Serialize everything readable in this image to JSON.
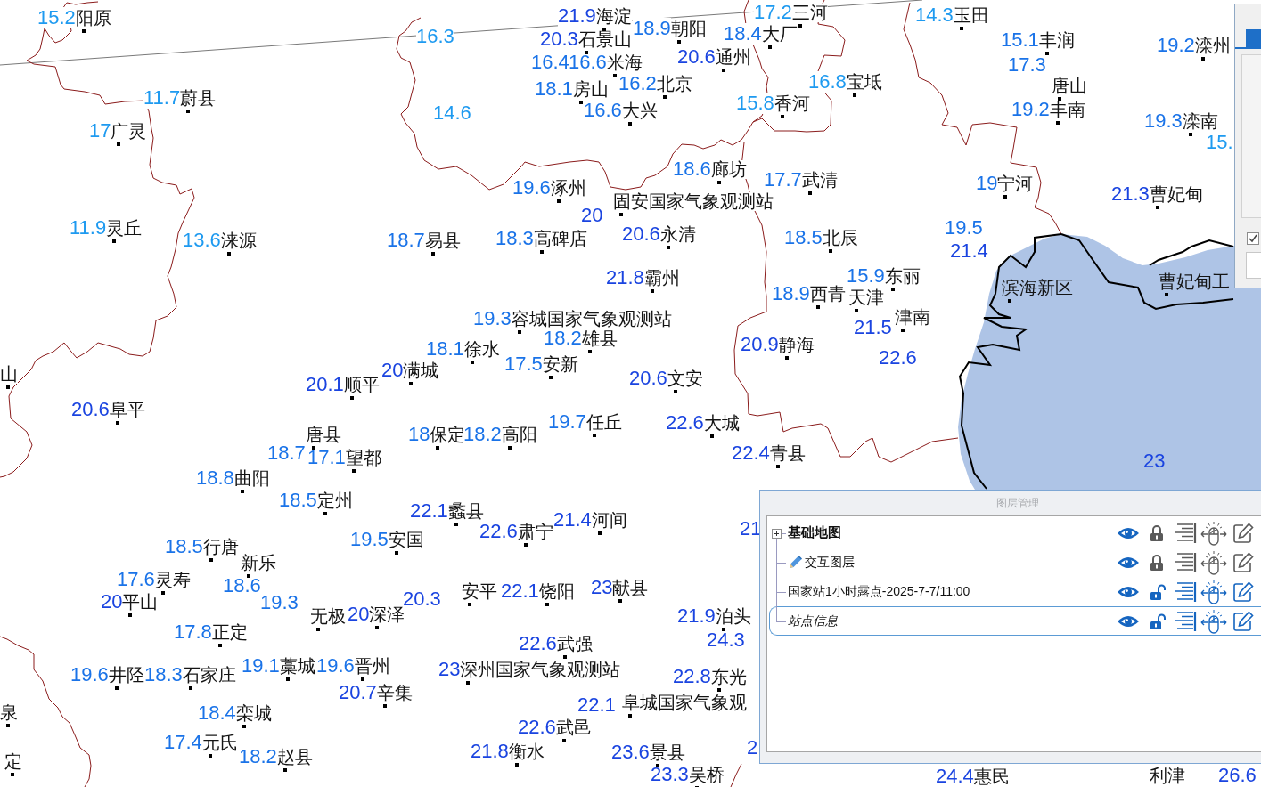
{
  "map": {
    "stations": [
      {
        "value": "15.2",
        "name": "阳原",
        "color": "#1e9af0"
      },
      {
        "value": "21.9",
        "name": "海淀",
        "color": "#1a44e0"
      },
      {
        "value": "17.2",
        "name": "三河",
        "color": "#1e9af0"
      },
      {
        "value": "14.3",
        "name": "玉田",
        "color": "#1e9af0"
      },
      {
        "value": "16.3",
        "color": "#1e9af0"
      },
      {
        "value": "20.3",
        "name": "石景山",
        "color": "#1a44e0"
      },
      {
        "value": "18.9",
        "name": "朝阳",
        "color": "#1a73e8"
      },
      {
        "value": "18.4",
        "name": "大厂",
        "color": "#1a73e8"
      },
      {
        "value": "15.1",
        "name": "丰润",
        "color": "#1a73e8"
      },
      {
        "value": "19.2",
        "name": "滦州",
        "color": "#1a73e8"
      },
      {
        "value": "16.4",
        "color": "#1a73e8"
      },
      {
        "value": "16.6",
        "name": "米海",
        "color": "#1a73e8"
      },
      {
        "value": "20.6",
        "name": "通州",
        "color": "#1a44e0"
      },
      {
        "value": "17.3",
        "color": "#1a73e8"
      },
      {
        "value": "18.1",
        "name": "房山",
        "color": "#1a73e8"
      },
      {
        "value": "16.2",
        "name": "北京",
        "color": "#1a73e8"
      },
      {
        "value": "16.8",
        "name": "宝坻",
        "color": "#1e9af0"
      },
      {
        "name": "唐山"
      },
      {
        "value": "11.7",
        "name": "蔚县",
        "color": "#1e9af0"
      },
      {
        "value": "14.6",
        "color": "#1e9af0"
      },
      {
        "value": "16.6",
        "name": "大兴",
        "color": "#1a73e8"
      },
      {
        "value": "15.8",
        "name": "香河",
        "color": "#1e9af0"
      },
      {
        "value": "19.2",
        "name": "丰南",
        "color": "#1a73e8"
      },
      {
        "value": "17",
        "name": "广灵",
        "color": "#1e9af0"
      },
      {
        "value": "19.3",
        "name": "滦南",
        "color": "#1a73e8"
      },
      {
        "value": "15.",
        "color": "#1e9af0"
      },
      {
        "value": "19.6",
        "name": "涿州",
        "color": "#1a73e8"
      },
      {
        "value": "18.6",
        "name": "廊坊",
        "color": "#1a73e8"
      },
      {
        "value": "17.7",
        "name": "武清",
        "color": "#1a73e8"
      },
      {
        "value": "19",
        "name": "宁河",
        "color": "#1a73e8"
      },
      {
        "value": "21.3",
        "name": "曹妃甸",
        "color": "#1a44e0"
      },
      {
        "value": "11.9",
        "name": "灵丘",
        "color": "#1e9af0"
      },
      {
        "name": "固安国家气象观测站"
      },
      {
        "value": "20",
        "color": "#1a44e0"
      },
      {
        "value": "13.6",
        "name": "涞源",
        "color": "#1e9af0"
      },
      {
        "value": "18.7",
        "name": "易县",
        "color": "#1a73e8"
      },
      {
        "value": "18.3",
        "name": "高碑店",
        "color": "#1a73e8"
      },
      {
        "value": "20.6",
        "name": "永清",
        "color": "#1a44e0"
      },
      {
        "value": "18.5",
        "name": "北辰",
        "color": "#1a73e8"
      },
      {
        "value": "19.5",
        "color": "#1a73e8"
      },
      {
        "value": "21.4",
        "color": "#1a44e0"
      },
      {
        "value": "21.8",
        "name": "霸州",
        "color": "#1a44e0"
      },
      {
        "value": "18.9",
        "name": "西青",
        "color": "#1a73e8"
      },
      {
        "value": "15.9",
        "name": "东丽",
        "color": "#1a73e8"
      },
      {
        "name": "天津"
      },
      {
        "name": "滨海新区"
      },
      {
        "name": "曹妃甸工"
      },
      {
        "value": "19.3",
        "name": "容城国家气象观测站",
        "color": "#1a73e8"
      },
      {
        "value": "21.5",
        "color": "#1a44e0"
      },
      {
        "name": "津南"
      },
      {
        "value": "18.1",
        "name": "徐水",
        "color": "#1a73e8"
      },
      {
        "value": "18.2",
        "name": "雄县",
        "color": "#1a73e8"
      },
      {
        "value": "20.9",
        "name": "静海",
        "color": "#1a44e0"
      },
      {
        "name": "山"
      },
      {
        "value": "20.1",
        "name": "顺平",
        "color": "#1a44e0"
      },
      {
        "value": "20",
        "name": "满城",
        "color": "#1a44e0"
      },
      {
        "value": "17.5",
        "name": "安新",
        "color": "#1a73e8"
      },
      {
        "value": "20.6",
        "name": "文安",
        "color": "#1a44e0"
      },
      {
        "value": "22.6",
        "color": "#1a44e0"
      },
      {
        "value": "20.6",
        "name": "阜平",
        "color": "#1a44e0"
      },
      {
        "name": "唐县"
      },
      {
        "value": "18",
        "name": "保定",
        "color": "#1a73e8"
      },
      {
        "value": "18.2",
        "name": "高阳",
        "color": "#1a73e8"
      },
      {
        "value": "19.7",
        "name": "任丘",
        "color": "#1a73e8"
      },
      {
        "value": "22.6",
        "name": "大城",
        "color": "#1a44e0"
      },
      {
        "value": "18.7",
        "color": "#1a73e8"
      },
      {
        "value": "17.1",
        "name": "望都",
        "color": "#1a73e8"
      },
      {
        "value": "22.4",
        "name": "青县",
        "color": "#1a44e0"
      },
      {
        "value": "23",
        "color": "#1a44e0"
      },
      {
        "value": "18.8",
        "name": "曲阳",
        "color": "#1a73e8"
      },
      {
        "value": "18.5",
        "name": "定州",
        "color": "#1a73e8"
      },
      {
        "value": "22.1",
        "name": "蠡县",
        "color": "#1a44e0"
      },
      {
        "value": "18.5",
        "name": "行唐",
        "color": "#1a73e8"
      },
      {
        "value": "19.5",
        "name": "安国",
        "color": "#1a73e8"
      },
      {
        "value": "22.6",
        "name": "肃宁",
        "color": "#1a44e0"
      },
      {
        "value": "21.4",
        "name": "河间",
        "color": "#1a44e0"
      },
      {
        "value": "21",
        "color": "#1a44e0"
      },
      {
        "name": "新乐"
      },
      {
        "value": "17.6",
        "name": "灵寿",
        "color": "#1a73e8"
      },
      {
        "value": "18.6",
        "color": "#1a73e8"
      },
      {
        "value": "20",
        "name": "平山",
        "color": "#1a44e0"
      },
      {
        "value": "19.3",
        "color": "#1a73e8"
      },
      {
        "value": "20.3",
        "color": "#1a44e0"
      },
      {
        "name": "安平"
      },
      {
        "value": "22.1",
        "name": "饶阳",
        "color": "#1a44e0"
      },
      {
        "value": "23",
        "name": "献县",
        "color": "#1a44e0"
      },
      {
        "name": "无极"
      },
      {
        "value": "20",
        "name": "深泽",
        "color": "#1a44e0"
      },
      {
        "value": "21.9",
        "name": "泊头",
        "color": "#1a44e0"
      },
      {
        "value": "17.8",
        "name": "正定",
        "color": "#1a73e8"
      },
      {
        "value": "22.6",
        "name": "武强",
        "color": "#1a44e0"
      },
      {
        "value": "24.3",
        "color": "#1a44e0"
      },
      {
        "value": "19.6",
        "name": "井陉",
        "color": "#1a73e8"
      },
      {
        "value": "18.3",
        "name": "石家庄",
        "color": "#1a73e8"
      },
      {
        "value": "19.1",
        "name": "藁城",
        "color": "#1a73e8"
      },
      {
        "value": "19.6",
        "name": "晋州",
        "color": "#1a73e8"
      },
      {
        "value": "23",
        "name": "深州国家气象观测站",
        "color": "#1a44e0"
      },
      {
        "value": "22.8",
        "name": "东光",
        "color": "#1a44e0"
      },
      {
        "value": "20.7",
        "name": "辛集",
        "color": "#1a44e0"
      },
      {
        "value": "22.1",
        "color": "#1a44e0"
      },
      {
        "name": "阜城国家气象观"
      },
      {
        "name": "泉"
      },
      {
        "value": "18.4",
        "name": "栾城",
        "color": "#1a73e8"
      },
      {
        "value": "22.6",
        "name": "武邑",
        "color": "#1a44e0"
      },
      {
        "value": "17.4",
        "name": "元氏",
        "color": "#1a73e8"
      },
      {
        "name": "定"
      },
      {
        "value": "18.2",
        "name": "赵县",
        "color": "#1a73e8"
      },
      {
        "value": "21.8",
        "name": "衡水",
        "color": "#1a44e0"
      },
      {
        "value": "23.6",
        "name": "景县",
        "color": "#1a44e0"
      },
      {
        "value": "2",
        "color": "#1a44e0"
      },
      {
        "value": "23.3",
        "name": "吴桥",
        "color": "#1a44e0"
      },
      {
        "value": "24.4",
        "name": "惠民",
        "color": "#1a44e0"
      },
      {
        "name": "利津"
      },
      {
        "value": "26.6",
        "color": "#1a44e0"
      }
    ]
  },
  "side_panel": {
    "tabs": [
      {
        "selected": true
      }
    ],
    "checkbox": {
      "checked": true
    }
  },
  "layer_dialog": {
    "title": "图层管理",
    "layers": [
      {
        "kind": "group",
        "name": "基础地图",
        "expanded": false,
        "visible": true,
        "locked": true,
        "selected": false
      },
      {
        "kind": "draw",
        "name": "交互图层",
        "visible": true,
        "locked": true,
        "selected": false
      },
      {
        "kind": "data",
        "name": "国家站1小时露点-2025-7-7/11:00",
        "visible": true,
        "locked": false,
        "selected": false
      },
      {
        "kind": "label",
        "name": "站点信息",
        "visible": true,
        "locked": false,
        "selected": true
      }
    ]
  }
}
